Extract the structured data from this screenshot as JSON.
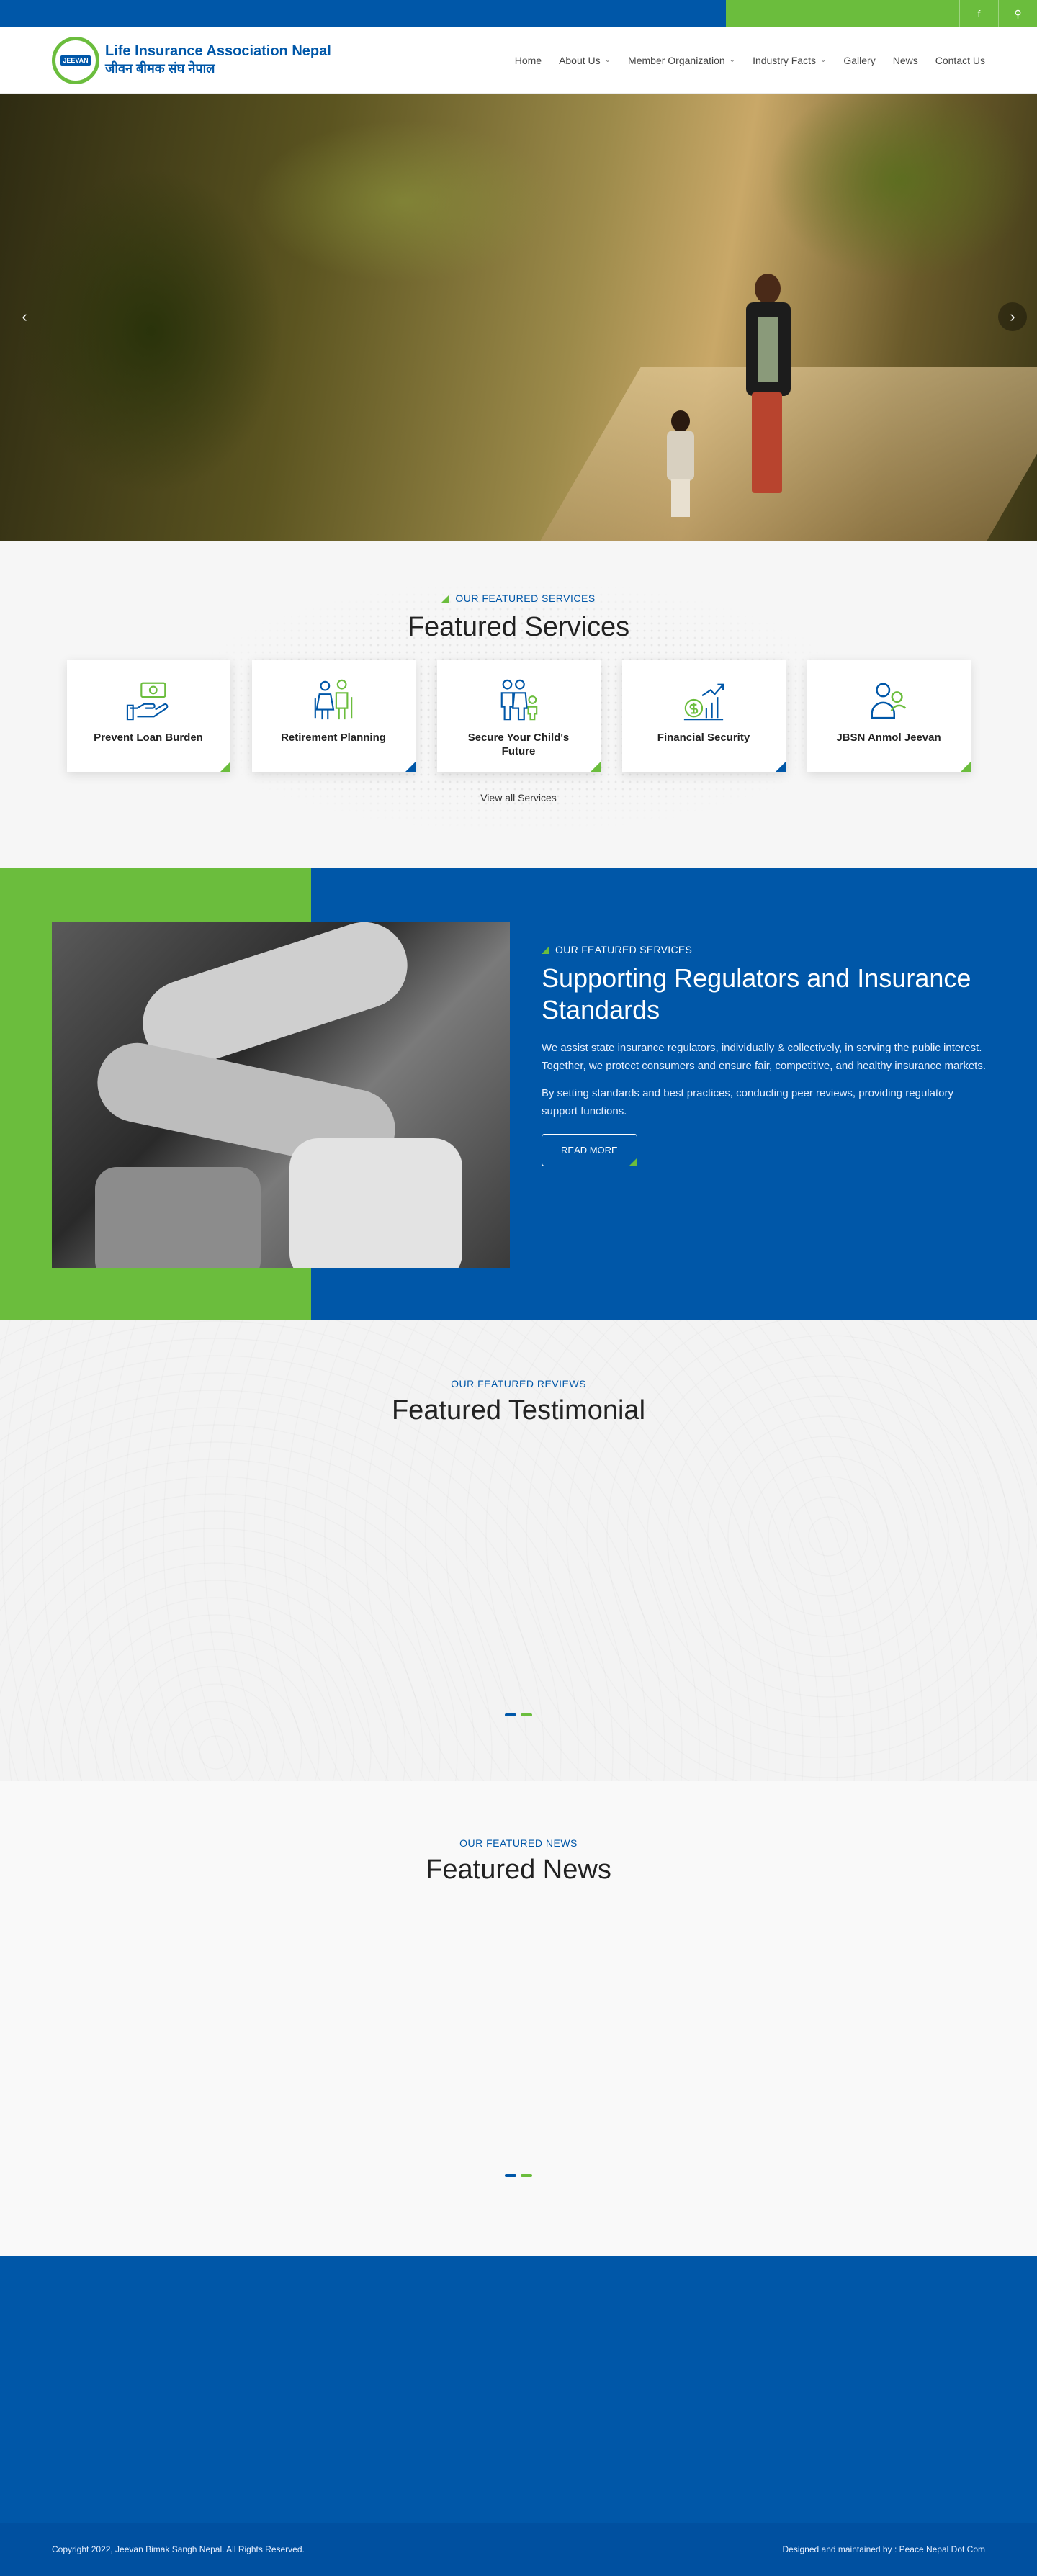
{
  "topbar": {
    "facebook_icon": "facebook-icon",
    "search_icon": "search-icon",
    "facebook_glyph": "f",
    "search_glyph": "⚲"
  },
  "header": {
    "logo_emblem_text": "JEEVAN",
    "logo_title": "Life Insurance Association Nepal",
    "logo_subtitle": "जीवन बीमक संघ नेपाल",
    "nav": [
      {
        "label": "Home",
        "has_dropdown": false
      },
      {
        "label": "About Us",
        "has_dropdown": true
      },
      {
        "label": "Member Organization",
        "has_dropdown": true
      },
      {
        "label": "Industry Facts",
        "has_dropdown": true
      },
      {
        "label": "Gallery",
        "has_dropdown": false
      },
      {
        "label": "News",
        "has_dropdown": false
      },
      {
        "label": "Contact Us",
        "has_dropdown": false
      }
    ]
  },
  "hero": {
    "prev_glyph": "‹",
    "next_glyph": "›"
  },
  "services": {
    "eyebrow": "OUR FEATURED SERVICES",
    "title": "Featured Services",
    "cards": [
      {
        "label": "Prevent Loan Burden",
        "icon": "loan-hand-icon",
        "corner": "green"
      },
      {
        "label": "Retirement Planning",
        "icon": "elderly-couple-icon",
        "corner": "blue"
      },
      {
        "label": "Secure Your Child's Future",
        "icon": "family-icon",
        "corner": "green"
      },
      {
        "label": "Financial Security",
        "icon": "growth-chart-icon",
        "corner": "blue"
      },
      {
        "label": "JBSN Anmol Jeevan",
        "icon": "people-icon",
        "corner": "green"
      }
    ],
    "view_all": "View all Services"
  },
  "regulators": {
    "eyebrow": "OUR FEATURED SERVICES",
    "title": "Supporting Regulators and Insurance Standards",
    "paragraph1": "We assist state insurance regulators, individually & collectively, in serving the public interest. Together, we protect consumers and ensure fair, competitive, and healthy insurance markets.",
    "paragraph2": "By setting standards and best practices, conducting peer reviews, providing regulatory support functions.",
    "button": "READ MORE"
  },
  "testimonial": {
    "eyebrow": "OUR FEATURED REVIEWS",
    "title": "Featured Testimonial"
  },
  "news": {
    "eyebrow": "OUR FEATURED NEWS",
    "title": "Featured News"
  },
  "footer": {
    "copyright": "Copyright 2022, Jeevan Bimak Sangh Nepal. All Rights Reserved.",
    "credit": "Designed and maintained by : Peace Nepal Dot Com"
  },
  "colors": {
    "brand_blue": "#0057a8",
    "brand_green": "#6bbd3d"
  }
}
